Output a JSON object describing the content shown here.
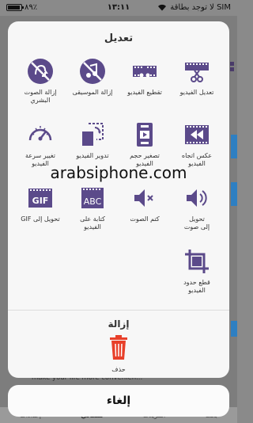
{
  "status_bar": {
    "carrier": "لا توجد بطاقة SIM",
    "time": "١٣:١١",
    "battery": "٨٩٪"
  },
  "background": {
    "ad_text": "make your life more convenien...",
    "tabs": [
      "إعدادات",
      "ملفاتي",
      "التنزيلات",
      "بحث"
    ],
    "active_tab": "ملفاتي"
  },
  "sheet": {
    "title": "تعديل",
    "items": [
      {
        "label": "تعديل الفيديو",
        "icon": "film-scissors-icon"
      },
      {
        "label": "تقطيع الفيديو",
        "icon": "film-cut-icon"
      },
      {
        "label": "إزالة الموسيقى",
        "icon": "music-off-icon"
      },
      {
        "label": "إزالة الصوت\nالبشري",
        "icon": "voice-off-icon"
      },
      {
        "label": "عكس اتجاه\nالفيديو",
        "icon": "rewind-film-icon"
      },
      {
        "label": "تصغير حجم\nالفيديو",
        "icon": "compress-clamp-icon"
      },
      {
        "label": "تدوير الفيديو",
        "icon": "rotate-icon"
      },
      {
        "label": "تغيير سرعة\nالفيديو",
        "icon": "speedometer-icon"
      },
      {
        "label": "تحويل\nإلى صوت",
        "icon": "speaker-icon"
      },
      {
        "label": "كتم الصوت",
        "icon": "speaker-mute-icon"
      },
      {
        "label": "كتابة على\nالفيديو",
        "icon": "text-film-icon"
      },
      {
        "label": "تحويل إلى GIF",
        "icon": "gif-film-icon"
      },
      {
        "label": "قطع حدود\nالفيديو",
        "icon": "crop-icon"
      }
    ],
    "remove_title": "إزالة",
    "delete_label": "حذف"
  },
  "watermark": "arabsiphone.com",
  "cancel_label": "إلغاء",
  "colors": {
    "accent": "#5b4a8a",
    "delete": "#e8402a"
  }
}
